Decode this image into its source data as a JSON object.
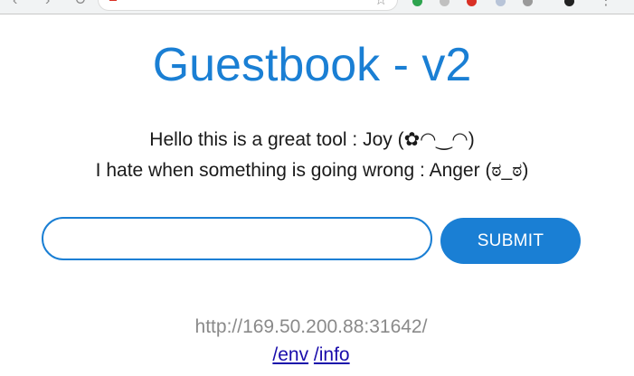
{
  "page": {
    "title": "Guestbook - v2",
    "messages": [
      "Hello this is a great tool : Joy (✿◠‿◠)",
      "I hate when something is going wrong : Anger (ಠ_ಠ)"
    ],
    "entry_input": {
      "value": "",
      "placeholder": ""
    },
    "submit_label": "SUBMIT",
    "address": "http://169.50.200.88:31642/",
    "links": {
      "env": "/env",
      "info": "/info"
    }
  },
  "colors": {
    "accent": "#1a7fd4",
    "text": "#1a1a1a",
    "muted": "#8a8a8a",
    "link": "#1a0dab"
  }
}
